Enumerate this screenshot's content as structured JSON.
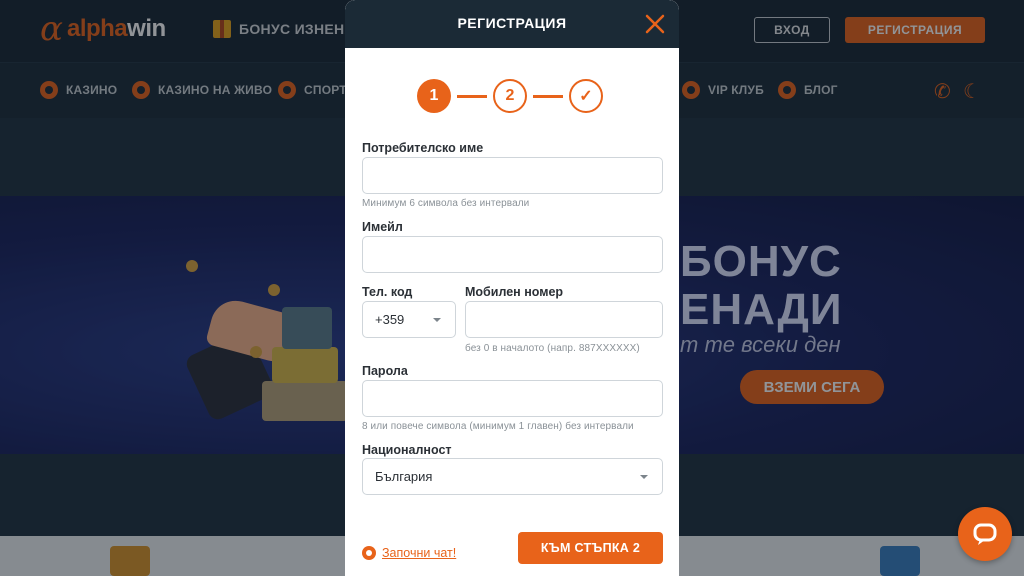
{
  "site": {
    "logo_text_orange": "alpha",
    "logo_text_white": "win",
    "bonus_link": "БОНУС ИЗНЕНА",
    "login_button": "ВХОД",
    "register_button": "РЕГИСТРАЦИЯ",
    "nav": [
      {
        "label": "КАЗИНО",
        "icon": "casino-icon"
      },
      {
        "label": "КАЗИНО НА ЖИВО",
        "icon": "live-casino-icon"
      },
      {
        "label": "СПОРТ",
        "icon": "sport-icon"
      },
      {
        "label": "VIP КЛУБ",
        "icon": "vip-icon"
      },
      {
        "label": "БЛОГ",
        "icon": "blog-icon"
      }
    ],
    "banner": {
      "title_line1": "БОНУС",
      "title_line2": "ЕНАДИ",
      "subtitle": "т те всеки ден",
      "cta": "ВЗЕМИ СЕГА"
    }
  },
  "modal": {
    "title": "РЕГИСТРАЦИЯ",
    "steps": [
      "1",
      "2",
      "✓"
    ],
    "active_step": 1,
    "username": {
      "label": "Потребителско име",
      "value": "",
      "hint": "Минимум 6 символа без интервали"
    },
    "email": {
      "label": "Имейл",
      "value": ""
    },
    "phone_code": {
      "label": "Тел. код",
      "value": "+359"
    },
    "mobile": {
      "label": "Мобилен номер",
      "value": "",
      "hint": "без 0 в началото (напр. 887XXXXXX)"
    },
    "password": {
      "label": "Парола",
      "value": "",
      "hint": "8 или повече символа (минимум 1 главен) без интервали"
    },
    "nationality": {
      "label": "Националност",
      "value": "България"
    },
    "live_chat": "Започни чат!",
    "next_button": "КЪМ СТЪПКА 2"
  },
  "colors": {
    "accent": "#e8631a",
    "header_bg": "#1b2a36",
    "banner_bg": "#1a235e"
  }
}
